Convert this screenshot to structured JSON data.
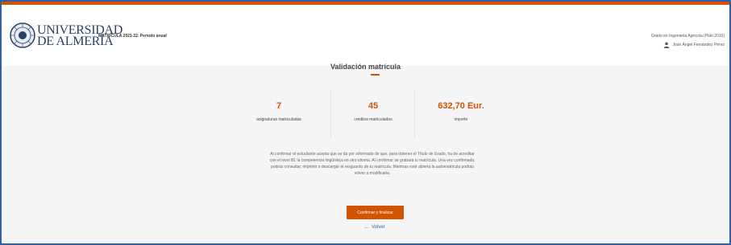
{
  "header": {
    "university_name_line1": "UNIVERSIDAD",
    "university_name_line2": "DE ALMERÍA",
    "course_label": "MATRÍCULA 2021-22. Período anual",
    "degree": "Grado en Ingeniería Agrícola (Plan 2010)",
    "user_name": "José Ángel Fernández Pérez"
  },
  "main": {
    "title": "Validación matrícula",
    "stats": [
      {
        "value": "7",
        "label": "asignaturas matriculadas"
      },
      {
        "value": "45",
        "label": "créditos matriculados"
      },
      {
        "value": "632,70 Eur.",
        "label": "importe"
      }
    ],
    "notice": "Al confirmar el estudiante acepta que se da por informado de que, para obtener el Título de Grado, ha de acreditar con el nivel B1 la competencia lingüística en otro idioma. Al confirmar se grabará tu matrícula. Una vez confirmada, podrás consultar, imprimir o descargar el resguardo de tu matrícula. Mientras esté abierta la automatrícula podrás volver a modificarla.",
    "confirm_button": "Confirmar y finalizar",
    "back_link": "Volver"
  },
  "colors": {
    "accent": "#d35400",
    "frame": "#2f5fa7",
    "brand_text": "#2a3f66"
  }
}
